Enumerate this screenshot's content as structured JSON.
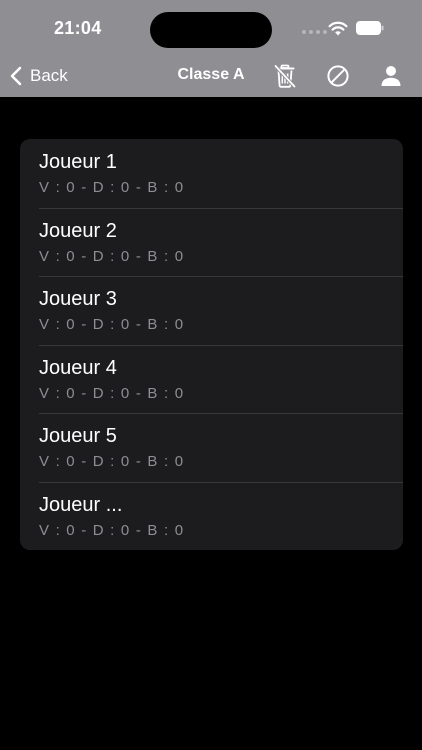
{
  "status_bar": {
    "time": "21:04"
  },
  "nav": {
    "back_label": "Back",
    "title": "Classe A",
    "icons": [
      "trash-slash-icon",
      "prohibited-icon",
      "person-icon"
    ]
  },
  "players": [
    {
      "name": "Joueur 1",
      "stats": "V : 0 - D : 0 - B : 0"
    },
    {
      "name": "Joueur 2",
      "stats": "V : 0 - D : 0 - B : 0"
    },
    {
      "name": "Joueur 3",
      "stats": "V : 0 - D : 0 - B : 0"
    },
    {
      "name": "Joueur 4",
      "stats": "V : 0 - D : 0 - B : 0"
    },
    {
      "name": "Joueur 5",
      "stats": "V : 0 - D : 0 - B : 0"
    },
    {
      "name": "Joueur ...",
      "stats": "V : 0 - D : 0 - B : 0"
    }
  ],
  "colors": {
    "nav_background": "#8e8e93",
    "page_background": "#000000",
    "card_background": "#1c1c1e",
    "separator": "#38383a",
    "secondary_text": "#8d8d92"
  }
}
